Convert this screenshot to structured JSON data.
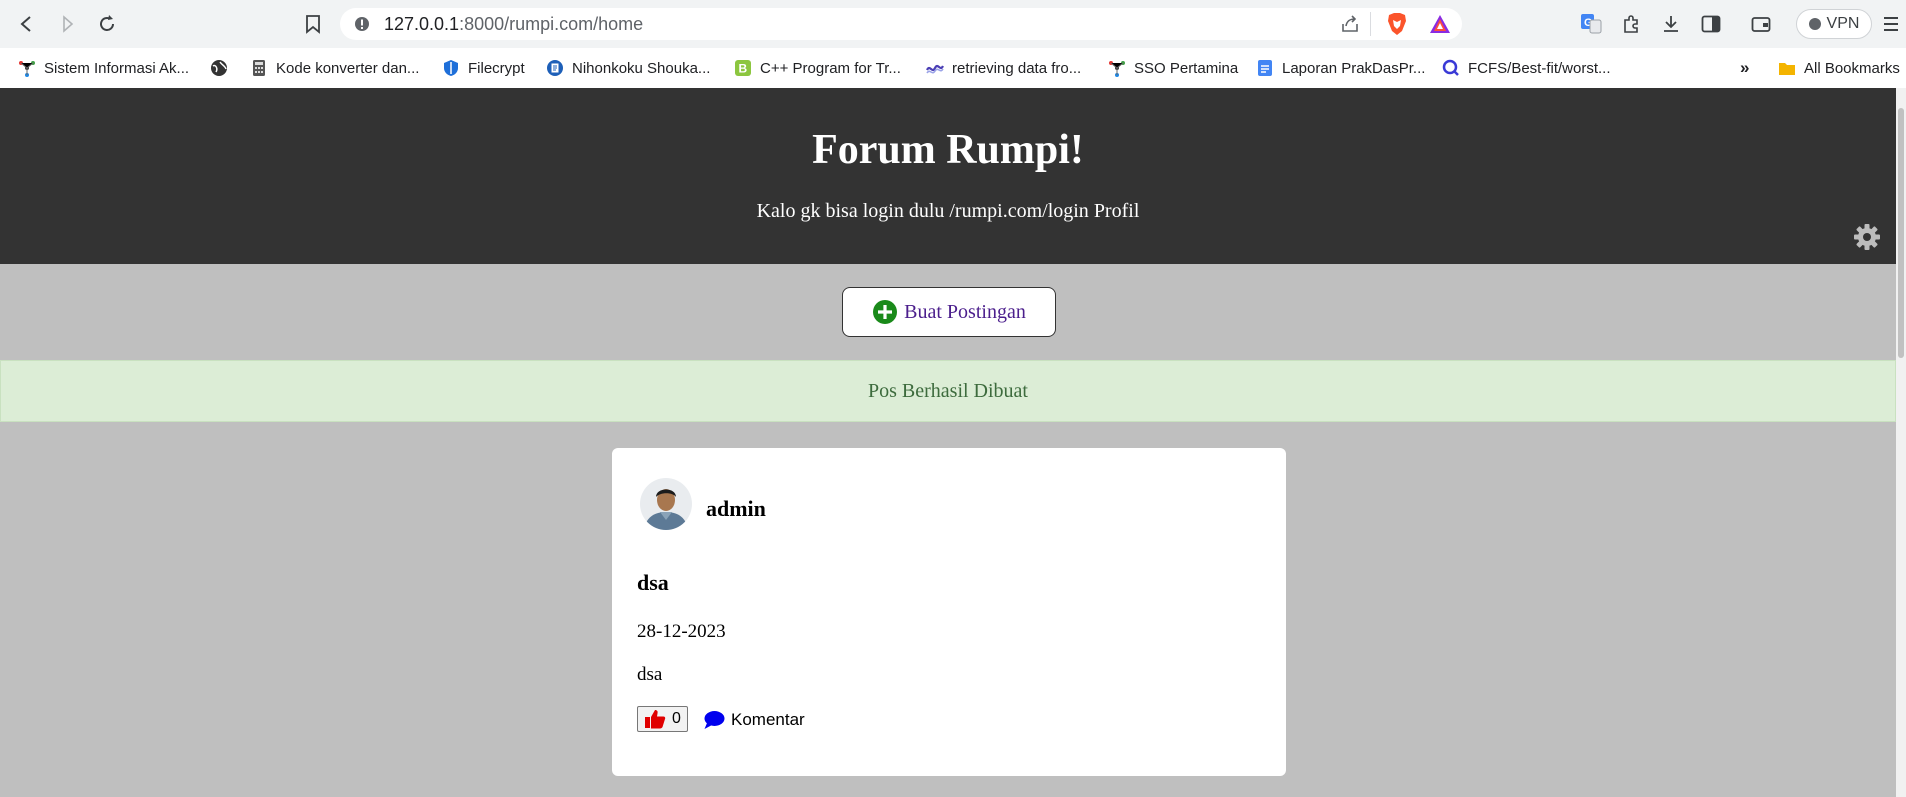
{
  "browser": {
    "url_host": "127.0.0.1",
    "url_path": ":8000/rumpi.com/home",
    "vpn_label": "VPN",
    "bookmarks": [
      {
        "label": "Sistem Informasi Ak..."
      },
      {
        "label": ""
      },
      {
        "label": "Kode konverter dan..."
      },
      {
        "label": "Filecrypt"
      },
      {
        "label": "Nihonkoku Shouka..."
      },
      {
        "label": "C++ Program for Tr..."
      },
      {
        "label": "retrieving data fro..."
      },
      {
        "label": "SSO Pertamina"
      },
      {
        "label": "Laporan PrakDasPr..."
      },
      {
        "label": "FCFS/Best-fit/worst..."
      }
    ],
    "more_label": "»",
    "all_bookmarks_label": "All Bookmarks"
  },
  "header": {
    "title": "Forum Rumpi!",
    "subtitle_prefix": "Kalo gk bisa login dulu /rumpi.com/login",
    "profile_link": "Profil"
  },
  "new_post_button": "Buat Postingan",
  "alert": "Pos Berhasil Dibuat",
  "post": {
    "author": "admin",
    "title": "dsa",
    "date": "28-12-2023",
    "body": "dsa",
    "likes": "0",
    "comment_label": "Komentar"
  },
  "colors": {
    "header_bg": "#333333",
    "page_bg": "#bfbfbf",
    "alert_bg": "#dcedd6",
    "like_icon": "#e00000",
    "comment_icon": "#0000ee",
    "plus_icon": "#1a8a1a"
  }
}
